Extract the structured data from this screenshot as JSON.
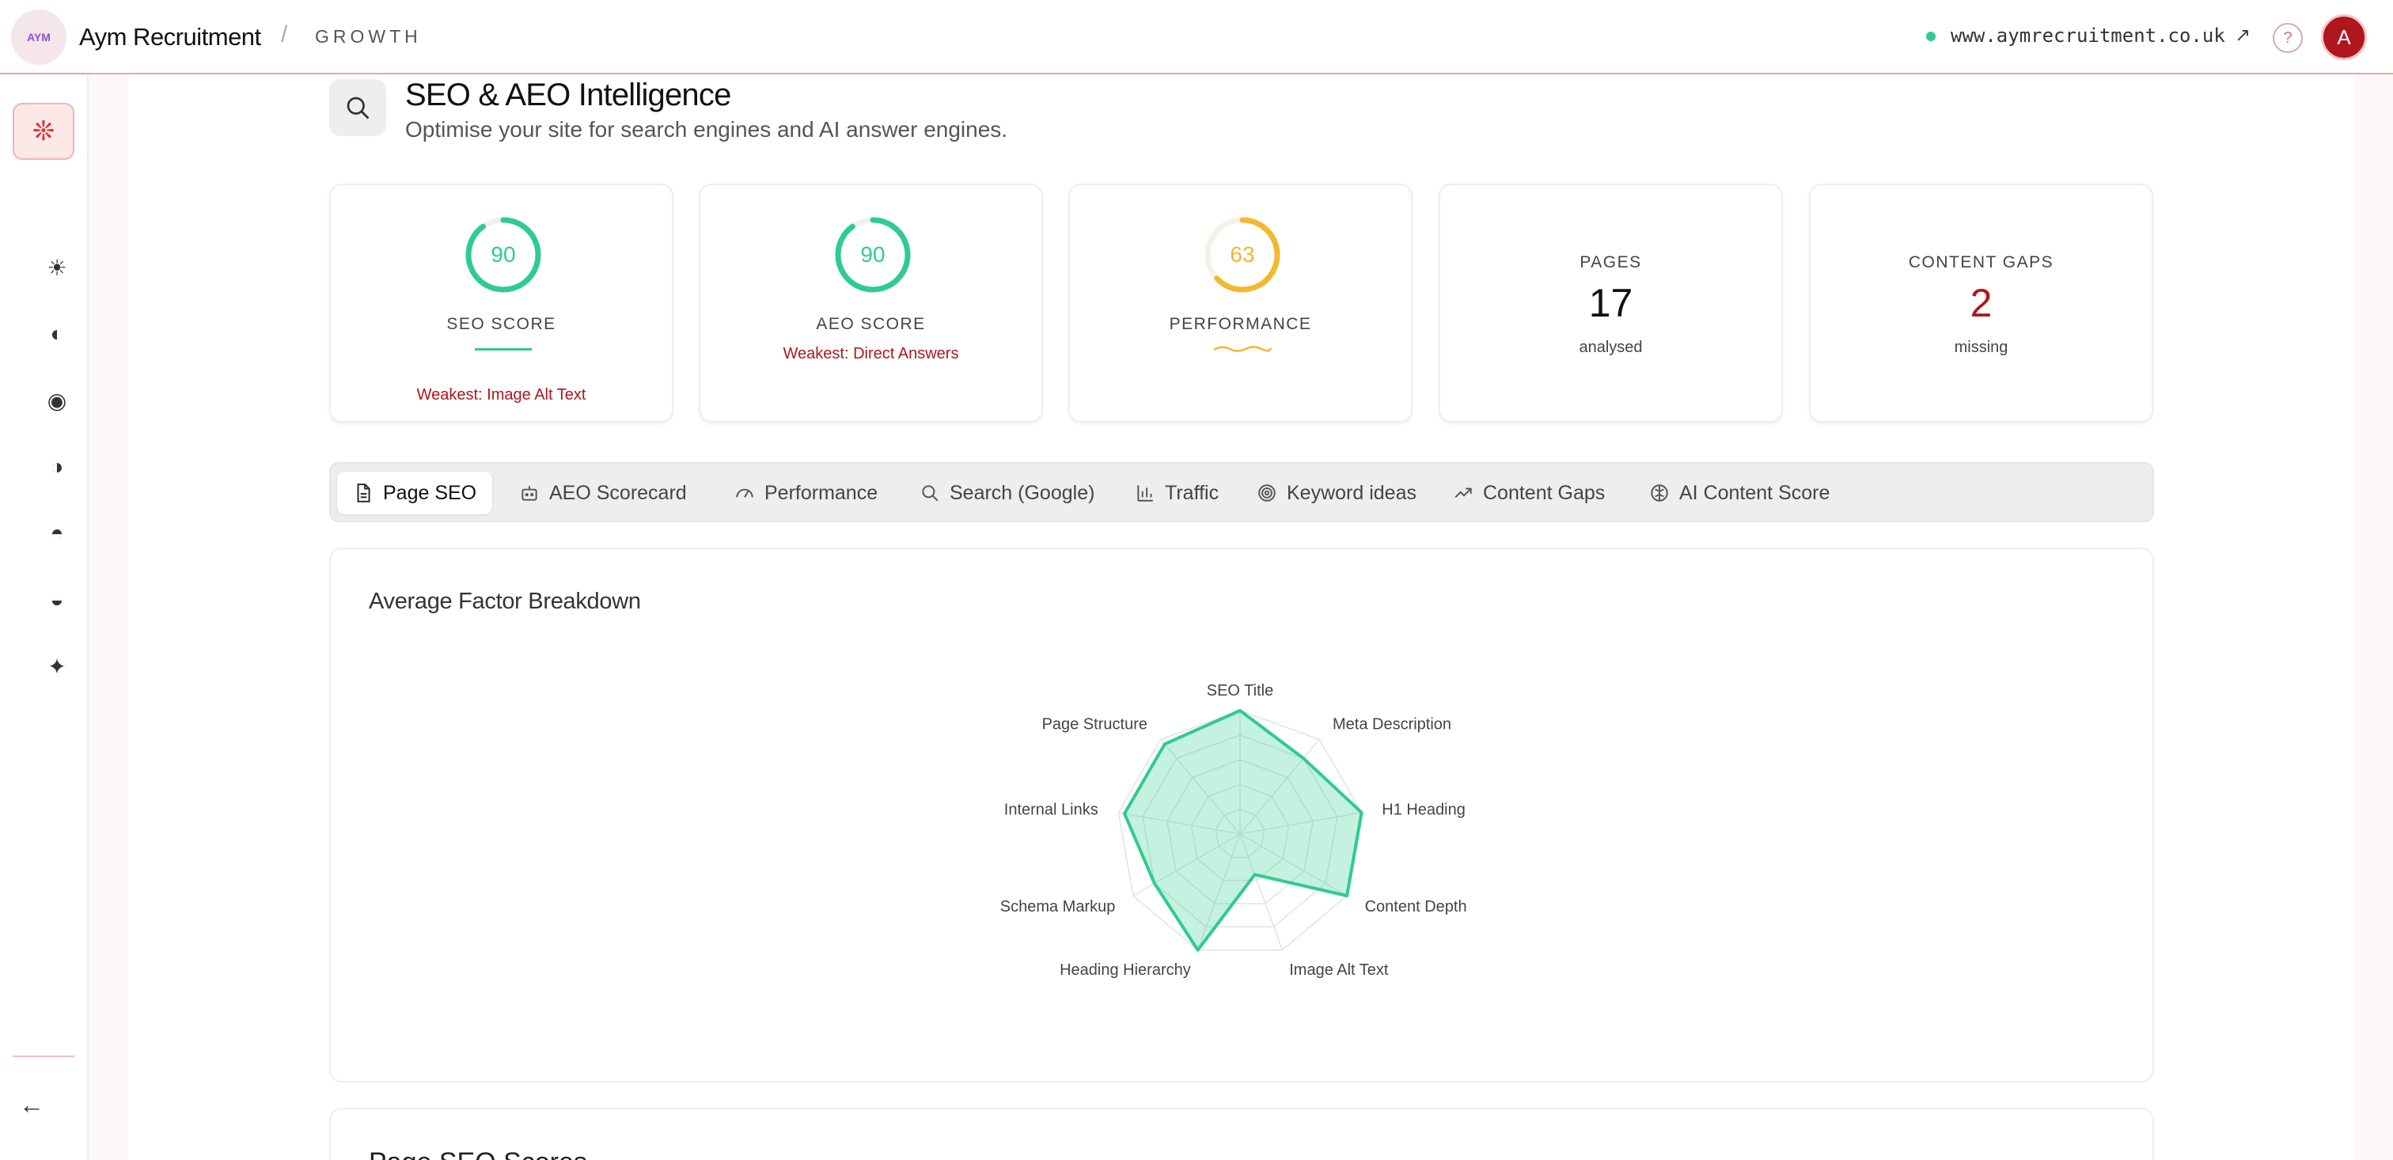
{
  "app": {
    "brand_name": "Aym Recruitment",
    "logo_text": "AYM",
    "separator": "/",
    "section": "GROWTH",
    "site_url": "www.aymrecruitment.co.uk",
    "external_icon": "↗",
    "help_label": "?",
    "avatar_initial": "A"
  },
  "sidebar": {
    "home_icon": "❊",
    "items": [
      {
        "icon": "sun-icon",
        "glyph": "☀"
      },
      {
        "icon": "half-circle-icon",
        "glyph": "◐"
      },
      {
        "icon": "target-icon",
        "glyph": "◉"
      },
      {
        "icon": "contrast-icon",
        "glyph": "◑"
      },
      {
        "icon": "top-half-circle-icon",
        "glyph": "◓"
      },
      {
        "icon": "bottom-half-circle-icon",
        "glyph": "◒"
      },
      {
        "icon": "sparkle-icon",
        "glyph": "✦"
      }
    ],
    "collapse_glyph": "←"
  },
  "page": {
    "title": "SEO & AEO Intelligence",
    "subtitle": "Optimise your site for search engines and AI answer engines."
  },
  "cards": {
    "seo": {
      "score": "90",
      "score_value": 90,
      "label": "SEO SCORE",
      "weakest": "Weakest: Image Alt Text"
    },
    "aeo": {
      "score": "90",
      "score_value": 90,
      "label": "AEO SCORE",
      "weakest": "Weakest: Direct Answers"
    },
    "performance": {
      "score": "63",
      "score_value": 63,
      "label": "PERFORMANCE"
    },
    "pages": {
      "label": "PAGES",
      "value": "17",
      "sub": "analysed"
    },
    "gaps": {
      "label": "CONTENT GAPS",
      "value": "2",
      "sub": "missing"
    }
  },
  "colors": {
    "good": "#2ecc8f",
    "warn": "#f2b82e",
    "danger": "#b0161e",
    "accent": "#e0312f"
  },
  "tabs": [
    {
      "label": "Page SEO",
      "icon": "document-icon",
      "active": true
    },
    {
      "label": "AEO Scorecard",
      "icon": "robot-icon"
    },
    {
      "label": "Performance",
      "icon": "gauge-icon"
    },
    {
      "label": "Search (Google)",
      "icon": "search-icon"
    },
    {
      "label": "Traffic",
      "icon": "bar-chart-icon"
    },
    {
      "label": "Keyword ideas",
      "icon": "target-icon"
    },
    {
      "label": "Content Gaps",
      "icon": "trend-icon"
    },
    {
      "label": "AI Content Score",
      "icon": "brain-icon"
    }
  ],
  "panel": {
    "title": "Average Factor Breakdown"
  },
  "next_panel": {
    "title": "Page SEO Scores"
  },
  "chart_data": {
    "type": "radar",
    "title": "Average Factor Breakdown",
    "categories": [
      "SEO Title",
      "Meta Description",
      "H1 Heading",
      "Content Depth",
      "Image Alt Text",
      "Heading Hierarchy",
      "Schema Markup",
      "Internal Links",
      "Page Structure"
    ],
    "values": [
      100,
      80,
      100,
      100,
      35,
      100,
      80,
      95,
      95
    ],
    "range": [
      0,
      100
    ],
    "grid": true
  }
}
